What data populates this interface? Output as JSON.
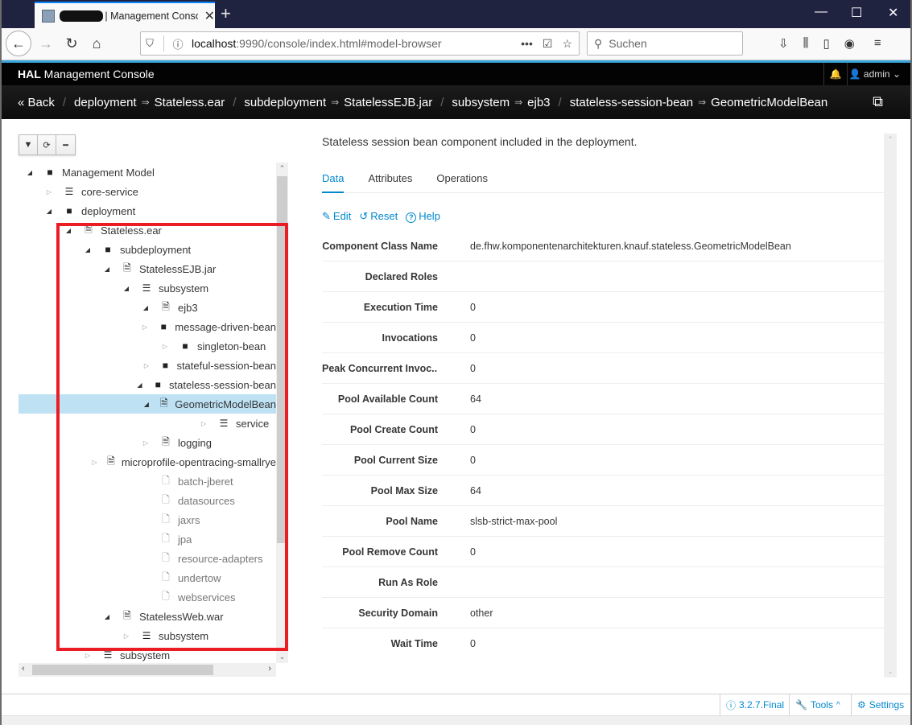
{
  "browser": {
    "tab_title": "| Management Console",
    "tab_close": "✕",
    "new_tab": "+",
    "window_controls": {
      "minimize": "—",
      "maximize": "☐",
      "close": "✕"
    },
    "url_host": "localhost",
    "url_path": ":9990/console/index.html#model-browser",
    "url_more": "•••",
    "search_placeholder": "Suchen",
    "icons": {
      "back": "←",
      "forward": "→",
      "reload": "↻",
      "home": "⌂",
      "shield": "⛉",
      "info": "ⓘ",
      "pocket": "☑",
      "bookmark": "☆",
      "search": "⚲",
      "downloads": "⇩",
      "library": "⫼",
      "sidebar": "▯",
      "account": "◉",
      "menu": "≡"
    }
  },
  "hal": {
    "brand_bold": "HAL",
    "brand_rest": " Management Console",
    "bell": "🔔",
    "user_label": "admin",
    "user_icon": "👤",
    "user_caret": "⌄"
  },
  "breadcrumb": {
    "back_label": "« Back",
    "segments": [
      {
        "key": "deployment",
        "value": "Stateless.ear"
      },
      {
        "key": "subdeployment",
        "value": "StatelessEJB.jar"
      },
      {
        "key": "subsystem",
        "value": "ejb3"
      },
      {
        "key": "stateless-session-bean",
        "value": "GeometricModelBean"
      }
    ],
    "arrow": "⇒",
    "slash": "/",
    "external_icon": "⧉"
  },
  "tree_toolbar": {
    "filter": "▼",
    "refresh": "⟳",
    "collapse": "━"
  },
  "tree": [
    {
      "label": "Management Model",
      "depth": 0,
      "toggle": "open",
      "icon": "folder"
    },
    {
      "label": "core-service",
      "depth": 1,
      "toggle": "closed",
      "icon": "list"
    },
    {
      "label": "deployment",
      "depth": 1,
      "toggle": "open",
      "icon": "folder"
    },
    {
      "label": "Stateless.ear",
      "depth": 2,
      "toggle": "open",
      "icon": "file"
    },
    {
      "label": "subdeployment",
      "depth": 3,
      "toggle": "open",
      "icon": "folder"
    },
    {
      "label": "StatelessEJB.jar",
      "depth": 4,
      "toggle": "open",
      "icon": "file"
    },
    {
      "label": "subsystem",
      "depth": 5,
      "toggle": "open",
      "icon": "list"
    },
    {
      "label": "ejb3",
      "depth": 6,
      "toggle": "open",
      "icon": "file"
    },
    {
      "label": "message-driven-bean",
      "depth": 7,
      "toggle": "closed",
      "icon": "folder"
    },
    {
      "label": "singleton-bean",
      "depth": 7,
      "toggle": "closed",
      "icon": "folder"
    },
    {
      "label": "stateful-session-bean",
      "depth": 7,
      "toggle": "closed",
      "icon": "folder"
    },
    {
      "label": "stateless-session-bean",
      "depth": 7,
      "toggle": "open",
      "icon": "folder"
    },
    {
      "label": "GeometricModelBean",
      "depth": 8,
      "toggle": "open",
      "icon": "file",
      "selected": true
    },
    {
      "label": "service",
      "depth": 9,
      "toggle": "closed",
      "icon": "list"
    },
    {
      "label": "logging",
      "depth": 6,
      "toggle": "closed",
      "icon": "file"
    },
    {
      "label": "microprofile-opentracing-smallrye",
      "depth": 6,
      "toggle": "closed",
      "icon": "file"
    },
    {
      "label": "batch-jberet",
      "depth": 6,
      "toggle": "none",
      "icon": "empty"
    },
    {
      "label": "datasources",
      "depth": 6,
      "toggle": "none",
      "icon": "empty"
    },
    {
      "label": "jaxrs",
      "depth": 6,
      "toggle": "none",
      "icon": "empty"
    },
    {
      "label": "jpa",
      "depth": 6,
      "toggle": "none",
      "icon": "empty"
    },
    {
      "label": "resource-adapters",
      "depth": 6,
      "toggle": "none",
      "icon": "empty"
    },
    {
      "label": "undertow",
      "depth": 6,
      "toggle": "none",
      "icon": "empty"
    },
    {
      "label": "webservices",
      "depth": 6,
      "toggle": "none",
      "icon": "empty"
    },
    {
      "label": "StatelessWeb.war",
      "depth": 4,
      "toggle": "open",
      "icon": "file"
    },
    {
      "label": "subsystem",
      "depth": 5,
      "toggle": "closed",
      "icon": "list"
    },
    {
      "label": "subsystem",
      "depth": 3,
      "toggle": "closed",
      "icon": "list"
    }
  ],
  "scroll_arrows": {
    "up": "⌃",
    "down": "⌄",
    "left": "‹",
    "right": "›"
  },
  "details": {
    "description": "Stateless session bean component included in the deployment.",
    "tabs": [
      {
        "label": "Data",
        "active": true
      },
      {
        "label": "Attributes",
        "active": false
      },
      {
        "label": "Operations",
        "active": false
      }
    ],
    "actions": [
      {
        "icon": "✎",
        "label": "Edit"
      },
      {
        "icon": "↺",
        "label": "Reset"
      },
      {
        "icon": "?",
        "label": "Help"
      }
    ],
    "attributes": [
      {
        "name": "Component Class Name",
        "value": "de.fhw.komponentenarchitekturen.knauf.stateless.GeometricModelBean"
      },
      {
        "name": "Declared Roles",
        "value": ""
      },
      {
        "name": "Execution Time",
        "value": "0"
      },
      {
        "name": "Invocations",
        "value": "0"
      },
      {
        "name": "Peak Concurrent Invoc...",
        "value": "0"
      },
      {
        "name": "Pool Available Count",
        "value": "64"
      },
      {
        "name": "Pool Create Count",
        "value": "0"
      },
      {
        "name": "Pool Current Size",
        "value": "0"
      },
      {
        "name": "Pool Max Size",
        "value": "64"
      },
      {
        "name": "Pool Name",
        "value": "slsb-strict-max-pool"
      },
      {
        "name": "Pool Remove Count",
        "value": "0"
      },
      {
        "name": "Run As Role",
        "value": ""
      },
      {
        "name": "Security Domain",
        "value": "other"
      },
      {
        "name": "Wait Time",
        "value": "0"
      }
    ]
  },
  "footer": {
    "version_icon": "ⓘ",
    "version": "3.2.7.Final",
    "tools_icon": "🔧",
    "tools": "Tools",
    "tools_caret": "^",
    "settings_icon": "⚙",
    "settings": "Settings"
  }
}
